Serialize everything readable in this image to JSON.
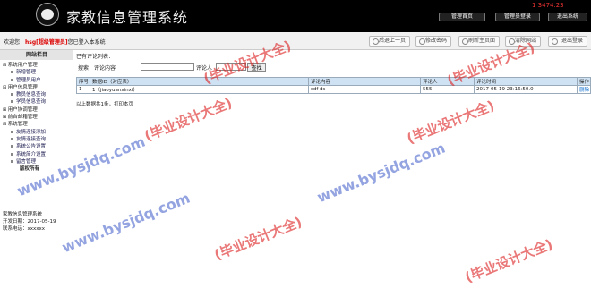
{
  "header": {
    "title": "家教信息管理系统",
    "corner_text": "1 3474.23",
    "buttons": [
      "管理首页",
      "管理员登录",
      "退出系统"
    ]
  },
  "toolbar": {
    "user_prefix": "欢迎您：",
    "user": "hsg[超级管理员]",
    "user_suffix": "您已登入本系统",
    "buttons": [
      "后退上一页",
      "修改密码",
      "刷新主页面",
      "清除网站",
      "退出登录"
    ]
  },
  "sidebar": {
    "heading": "网站栏目",
    "tree": [
      {
        "label": "系统用户管理",
        "type": "group"
      },
      {
        "label": "新增管理",
        "type": "item"
      },
      {
        "label": "管理员用户",
        "type": "item"
      },
      {
        "label": "用户信息管理",
        "type": "group"
      },
      {
        "label": "教员信息查询",
        "type": "item"
      },
      {
        "label": "学员信息查询",
        "type": "item"
      },
      {
        "label": "用户协调管理",
        "type": "group-closed"
      },
      {
        "label": "前台邮箱管理",
        "type": "group-closed"
      },
      {
        "label": "系统管理",
        "type": "group"
      },
      {
        "label": "友情连接添加",
        "type": "item"
      },
      {
        "label": "友情连接查询",
        "type": "item"
      },
      {
        "label": "系统公告设置",
        "type": "item"
      },
      {
        "label": "系统简介设置",
        "type": "item"
      },
      {
        "label": "留言管理",
        "type": "item"
      },
      {
        "label": "版权所有",
        "type": "plain"
      }
    ],
    "footer": {
      "system": "家教信息管理系统",
      "dev_date": "开发日期：2017-05-19",
      "phone": "联系电话：xxxxxx"
    }
  },
  "main": {
    "page_title": "已有评论列表：",
    "search": {
      "label1": "搜索：评论内容",
      "label2": "评论人",
      "button": "查找"
    },
    "table": {
      "headers": [
        "序号",
        "数据ID（对应表）",
        "评论内容",
        "评论人",
        "评论时间",
        "操作"
      ],
      "rows": [
        [
          "1",
          "1（jiaoyuanxinxi）",
          "sdf ds",
          "555",
          "2017-05-19 23:16:50.0",
          "删除"
        ]
      ]
    },
    "summary": "以上数据共1条，打印本页"
  },
  "watermarks": {
    "red": "(毕业设计大全)",
    "blue": "www.bysjdq.com"
  },
  "colors": {
    "header_bg": "#000000",
    "table_head": "#cfe2f3",
    "watermark_red": "#dc1e1e",
    "watermark_blue": "#3c5ac8"
  }
}
